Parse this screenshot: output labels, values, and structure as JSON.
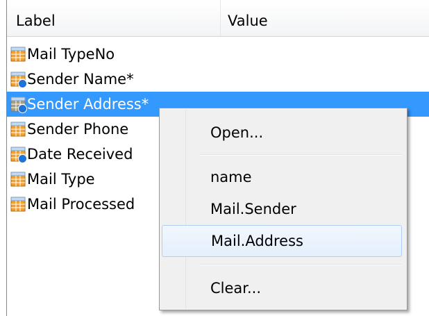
{
  "columns": {
    "label": "Label",
    "value": "Value"
  },
  "rows": [
    {
      "label": "Mail TypeNo",
      "icon": "table-field-icon",
      "value": ""
    },
    {
      "label": "Sender Name*",
      "icon": "table-field-info-icon",
      "value": ""
    },
    {
      "label": "Sender Address*",
      "icon": "table-field-info-icon",
      "value": "",
      "selected": true
    },
    {
      "label": "Sender Phone",
      "icon": "table-field-icon",
      "value": ""
    },
    {
      "label": "Date Received",
      "icon": "table-field-info-icon",
      "value": ""
    },
    {
      "label": "Mail Type",
      "icon": "table-field-icon",
      "value": ""
    },
    {
      "label": "Mail Processed",
      "icon": "table-field-icon",
      "value": ""
    }
  ],
  "context_menu": {
    "open": "Open...",
    "name": "name",
    "mail_sender": "Mail.Sender",
    "mail_address": "Mail.Address",
    "clear": "Clear..."
  },
  "colors": {
    "selection": "#3399ff",
    "menu_hover_border": "#aecff7",
    "info_badge": "#1e73d8",
    "icon_orange": "#f0a030"
  }
}
